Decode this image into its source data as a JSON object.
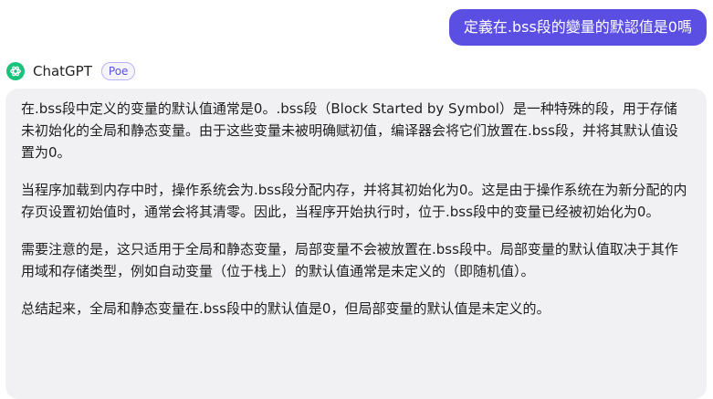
{
  "user_message": "定義在.bss段的變量的默認值是0嗎",
  "bot": {
    "name": "ChatGPT",
    "badge": "Poe",
    "brand_color": "#19c37d"
  },
  "accent_color": "#5b4fe3",
  "response_paragraphs": [
    "在.bss段中定义的变量的默认值通常是0。.bss段（Block Started by Symbol）是一种特殊的段，用于存储未初始化的全局和静态变量。由于这些变量未被明确赋初值，编译器会将它们放置在.bss段，并将其默认值设置为0。",
    "当程序加载到内存中时，操作系统会为.bss段分配内存，并将其初始化为0。这是由于操作系统在为新分配的内存页设置初始值时，通常会将其清零。因此，当程序开始执行时，位于.bss段中的变量已经被初始化为0。",
    "需要注意的是，这只适用于全局和静态变量，局部变量不会被放置在.bss段中。局部变量的默认值取决于其作用域和存储类型，例如自动变量（位于栈上）的默认值通常是未定义的（即随机值）。",
    "总结起来，全局和静态变量在.bss段中的默认值是0，但局部变量的默认值是未定义的。"
  ]
}
